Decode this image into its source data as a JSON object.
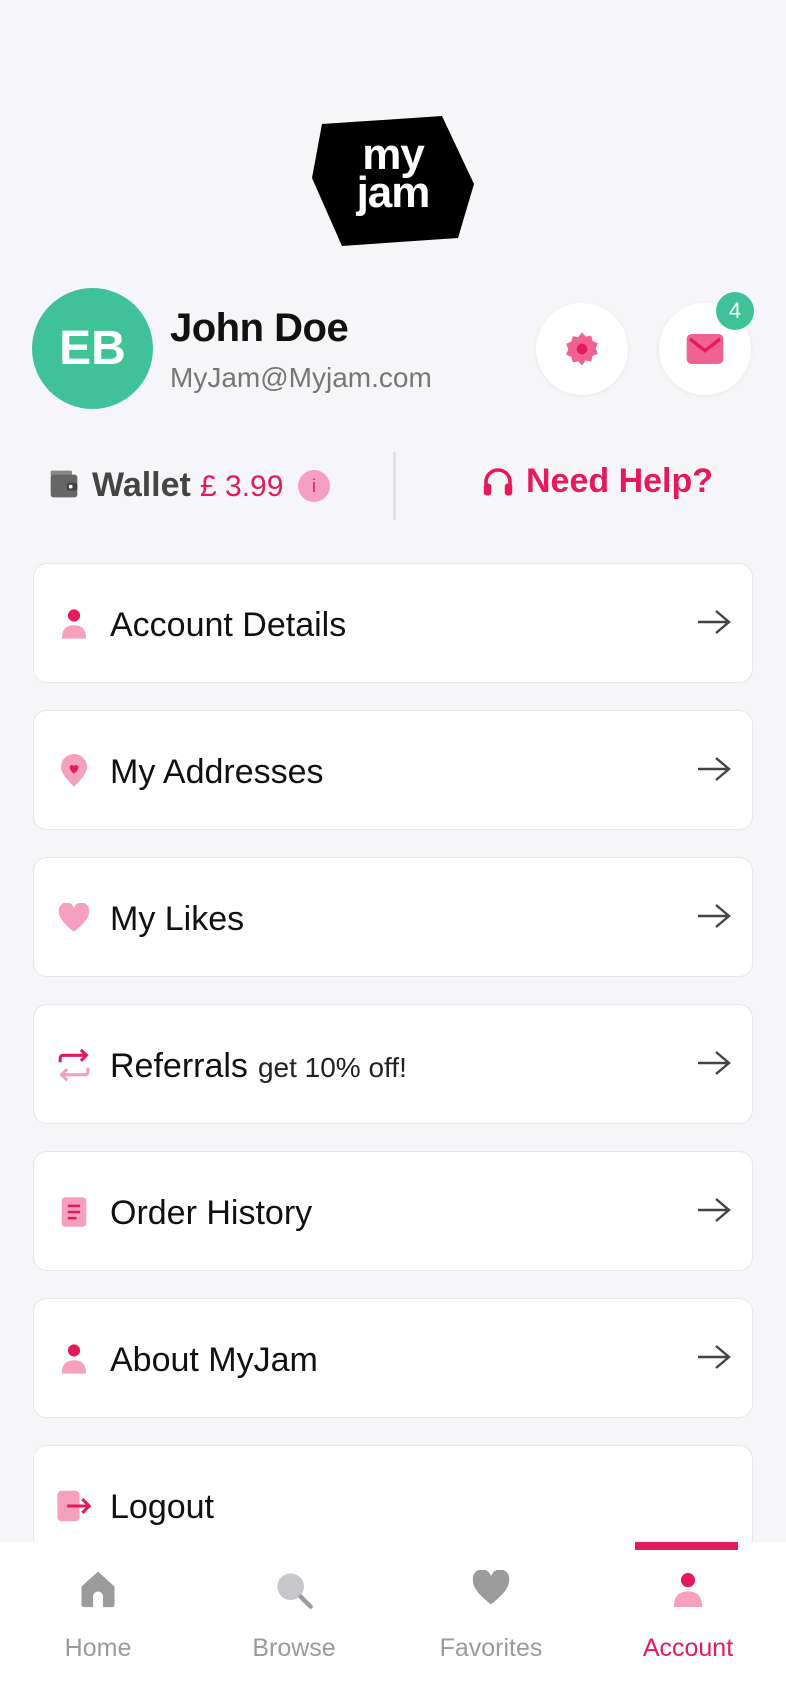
{
  "brand": {
    "logo_text": "my\njam",
    "accent_color": "#e5195e",
    "accent_light": "#f6a0bf",
    "green": "#3fc297"
  },
  "profile": {
    "initials": "EB",
    "name": "John Doe",
    "email": "MyJam@Myjam.com",
    "notification_count": "4",
    "settings_icon": "gear-icon",
    "inbox_icon": "mail-icon"
  },
  "wallet": {
    "label": "Wallet",
    "amount": "£ 3.99",
    "info_glyph": "i"
  },
  "help": {
    "label": "Need Help?"
  },
  "menu": [
    {
      "label": "Account Details",
      "icon": "user-icon"
    },
    {
      "label": "My Addresses",
      "icon": "location-heart-icon"
    },
    {
      "label": "My Likes",
      "icon": "heart-icon"
    },
    {
      "label": "Referrals",
      "sub": "get 10% off!",
      "icon": "referral-arrows-icon"
    },
    {
      "label": "Order History",
      "icon": "receipt-icon"
    },
    {
      "label": "About MyJam",
      "icon": "user-icon"
    },
    {
      "label": "Logout",
      "icon": "logout-icon"
    }
  ],
  "nav": [
    {
      "label": "Home",
      "icon": "home-icon"
    },
    {
      "label": "Browse",
      "icon": "search-icon"
    },
    {
      "label": "Favorites",
      "icon": "heart-icon"
    },
    {
      "label": "Account",
      "icon": "user-icon",
      "active": true
    }
  ]
}
